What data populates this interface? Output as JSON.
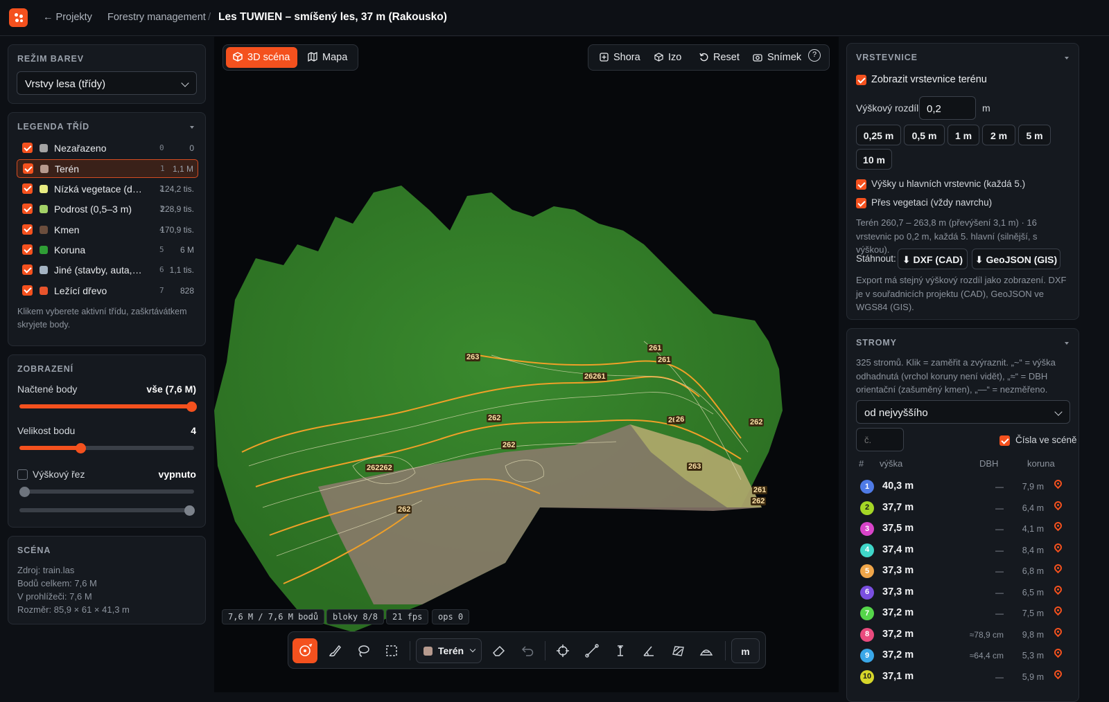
{
  "header": {
    "back_label": "← Projekty",
    "section": "Forestry management",
    "separator": "/",
    "title": "Les TUWIEN – smíšený les, 37 m (Rakousko)"
  },
  "color_mode": {
    "title": "REŽIM BAREV",
    "selected": "Vrstvy lesa (třídy)"
  },
  "legend": {
    "title": "LEGENDA TŘÍD",
    "items": [
      {
        "name": "Nezařazeno",
        "index": "0",
        "count": "0",
        "color": "#a3a3a3",
        "checked": true
      },
      {
        "name": "Terén",
        "index": "1",
        "count": "1,1 M",
        "color": "#b69a8e",
        "checked": true
      },
      {
        "name": "Nízká vegetace (do…",
        "index": "2",
        "count": "124,2 tis.",
        "color": "#e8ec82",
        "checked": true
      },
      {
        "name": "Podrost (0,5–3 m)",
        "index": "3",
        "count": "228,9 tis.",
        "color": "#a3d167",
        "checked": true
      },
      {
        "name": "Kmen",
        "index": "4",
        "count": "170,9 tis.",
        "color": "#6b4e3d",
        "checked": true
      },
      {
        "name": "Koruna",
        "index": "5",
        "count": "6 M",
        "color": "#2f9e35",
        "checked": true
      },
      {
        "name": "Jiné (stavby, auta, pře…",
        "index": "6",
        "count": "1,1 tis.",
        "color": "#a4b3c2",
        "checked": true
      },
      {
        "name": "Ležící dřevo",
        "index": "7",
        "count": "828",
        "color": "#e8542c",
        "checked": true
      }
    ],
    "hint": "Klikem vyberete aktivní třídu, zaškrtávátkem skryjete body."
  },
  "view": {
    "title": "ZOBRAZENÍ",
    "points_label": "Načtené body",
    "points_value": "vše (7,6 M)",
    "points_fraction": 1.0,
    "size_label": "Velikost bodu",
    "size_value": "4",
    "size_fraction": 0.35,
    "cut_label": "Výškový řez",
    "cut_value": "vypnuto"
  },
  "scene": {
    "title": "SCÉNA",
    "lines": [
      "Zdroj: train.las",
      "Bodů celkem: 7,6 M",
      "V prohlížeči: 7,6 M",
      "Rozměr: 85,9 × 61 × 41,3 m"
    ]
  },
  "viewport": {
    "mode_3d": "3D scéna",
    "mode_map": "Mapa",
    "views": [
      "Shora",
      "Izo",
      "Reset",
      "Snímek"
    ],
    "help": "?",
    "stats": [
      "7,6 M / 7,6 M bodů",
      "bloky 8/8",
      "21 fps",
      "ops 0"
    ],
    "contour_labels": [
      "263",
      "261",
      "261",
      "26261",
      "262",
      "262",
      "261",
      "262",
      "262262",
      "263",
      "262",
      "261",
      "262",
      "26"
    ],
    "active_class": "Terén",
    "unit_button": "m"
  },
  "contours": {
    "title": "VRSTEVNICE",
    "show_label": "Zobrazit vrstevnice terénu",
    "step_label": "Výškový rozdíl",
    "step_value": "0,2",
    "step_unit": "m",
    "presets": [
      "0,25 m",
      "0,5 m",
      "1 m",
      "2 m",
      "5 m",
      "10 m"
    ],
    "major_label": "Výšky u hlavních vrstevnic (každá 5.)",
    "over_veg_label": "Přes vegetaci (vždy navrchu)",
    "summary": "Terén 260,7 – 263,8 m (převýšení 3,1 m) · 16 vrstevnic po 0,2 m, každá 5. hlavní (silnější, s výškou).",
    "download_label": "Stáhnout:",
    "dxf": "⬇ DXF (CAD)",
    "geojson": "⬇ GeoJSON (GIS)",
    "export_note": "Export má stejný výškový rozdíl jako zobrazení. DXF je v souřadnicích projektu (CAD), GeoJSON ve WGS84 (GIS)."
  },
  "trees": {
    "title": "STROMY",
    "desc": "325 stromů. Klik = zaměřit a zvýraznit. „~“ = výška odhadnutá (vrchol koruny není vidět), „≈“ = DBH orientační (zašuměný kmen), „—“ = nezměřeno.",
    "sort": "od nejvyššího",
    "search_placeholder": "č.",
    "numbers_label": "Čísla ve scéně",
    "headers": {
      "num": "#",
      "height": "výška",
      "dbh": "DBH",
      "crown": "koruna"
    },
    "rows": [
      {
        "n": "1",
        "h": "40,3 m",
        "dbh": "—",
        "crown": "7,9 m",
        "color": "#4f7be6"
      },
      {
        "n": "2",
        "h": "37,7 m",
        "dbh": "—",
        "crown": "6,4 m",
        "color": "#a4d626"
      },
      {
        "n": "3",
        "h": "37,5 m",
        "dbh": "—",
        "crown": "4,1 m",
        "color": "#d844c9"
      },
      {
        "n": "4",
        "h": "37,4 m",
        "dbh": "—",
        "crown": "8,4 m",
        "color": "#3fd6c9"
      },
      {
        "n": "5",
        "h": "37,3 m",
        "dbh": "—",
        "crown": "6,8 m",
        "color": "#f0a64a"
      },
      {
        "n": "6",
        "h": "37,3 m",
        "dbh": "—",
        "crown": "6,5 m",
        "color": "#7a4fe0"
      },
      {
        "n": "7",
        "h": "37,2 m",
        "dbh": "—",
        "crown": "7,5 m",
        "color": "#55d64a"
      },
      {
        "n": "8",
        "h": "37,2 m",
        "dbh": "≈78,9 cm",
        "crown": "9,8 m",
        "color": "#ea4b7e"
      },
      {
        "n": "9",
        "h": "37,2 m",
        "dbh": "≈64,4 cm",
        "crown": "5,3 m",
        "color": "#3aa7e8"
      },
      {
        "n": "10",
        "h": "37,1 m",
        "dbh": "—",
        "crown": "5,9 m",
        "color": "#d6d62a"
      }
    ]
  },
  "colors": {
    "accent": "#f4511e",
    "bg": "#0d1015",
    "panel": "#15191f"
  }
}
